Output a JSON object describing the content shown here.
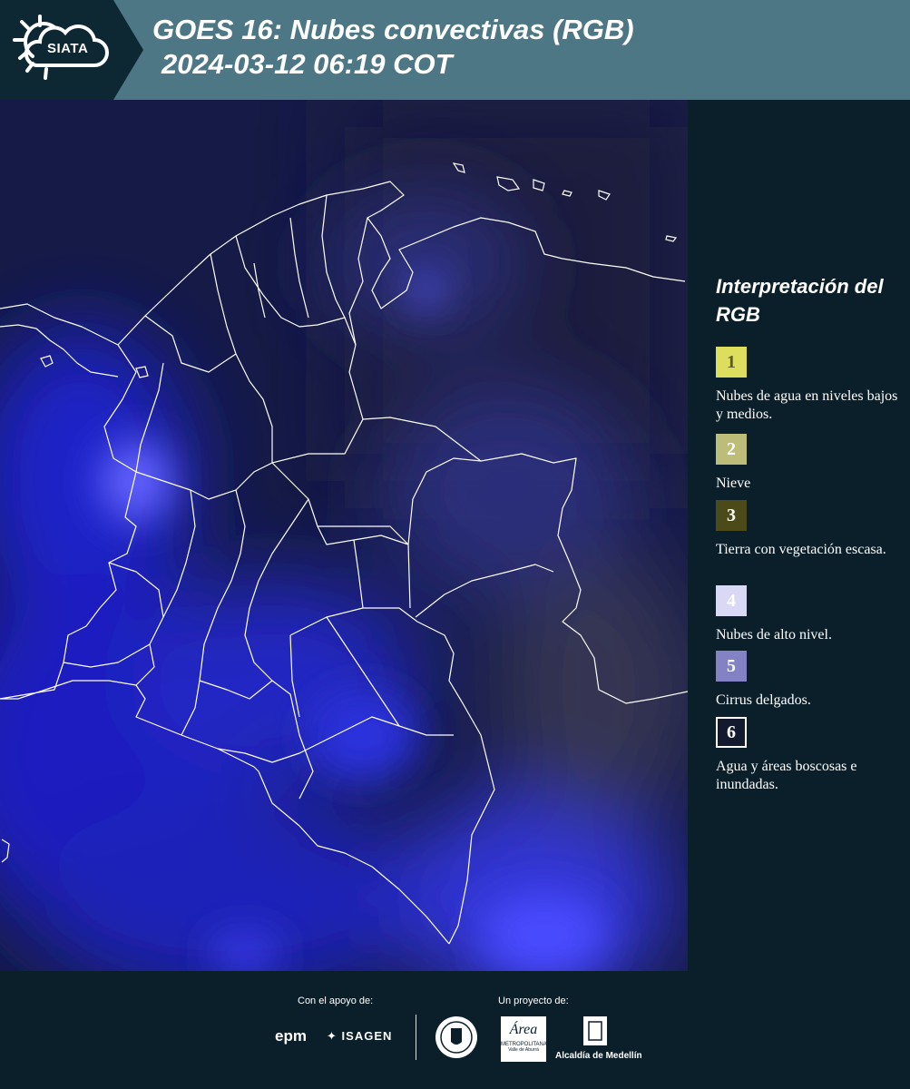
{
  "header": {
    "logo_text": "SIATA",
    "title_line1": "GOES 16: Nubes convectivas (RGB)",
    "title_line2": "2024-03-12 06:19 COT",
    "background_color": "#4d7784"
  },
  "map": {
    "description_icon": "satellite-rgb-map",
    "base_color": "#141a44",
    "cloud_color": "#3d3dff",
    "border_color": "#ffffff"
  },
  "legend": {
    "title": "Interpretación del RGB",
    "items": [
      {
        "number": "1",
        "label": "Nubes de agua en niveles bajos y medios.",
        "color": "#dede5e",
        "text_color": "#5a5a2a"
      },
      {
        "number": "2",
        "label": "Nieve",
        "color": "#bdbc78",
        "text_color": "#ffffff"
      },
      {
        "number": "3",
        "label": "Tierra con vegetación escasa.",
        "color": "#4c4a18",
        "text_color": "#ffffff"
      },
      {
        "number": "4",
        "label": "Nubes de alto nivel.",
        "color": "#d9d8f5",
        "text_color": "#ffffff"
      },
      {
        "number": "5",
        "label": "Cirrus delgados.",
        "color": "#8382c4",
        "text_color": "#ffffff"
      },
      {
        "number": "6",
        "label": "Agua y áreas boscosas e inundadas.",
        "color": "#141a2e",
        "text_color": "#ffffff"
      }
    ]
  },
  "footer": {
    "support_label": "Con el apoyo de:",
    "project_label": "Un proyecto de:",
    "epm": "epm",
    "isagen": "ISAGEN",
    "area_metro": "Área",
    "area_metro_sub": "METROPOLITANA",
    "area_metro_sub2": "Valle de Aburrá",
    "alcaldia": "Alcaldía de Medellín"
  }
}
